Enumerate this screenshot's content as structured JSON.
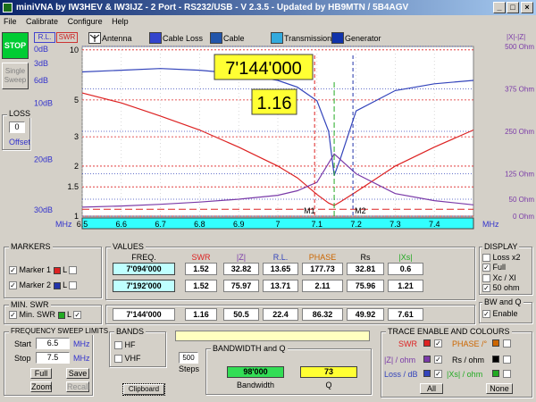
{
  "window": {
    "title": "miniVNA by IW3HEV & IW3IJZ - 2 Port - RS232/USB - V 2.3.5 - Updated by HB9MTN / 5B4AGV"
  },
  "menu": {
    "file": "File",
    "calibrate": "Calibrate",
    "configure": "Configure",
    "help": "Help"
  },
  "left": {
    "stop": "STOP",
    "single": "Single",
    "sweep": "Sweep",
    "loss_title": "LOSS",
    "loss_value": "0",
    "offset": "Offset"
  },
  "toolbar": {
    "rl": "R.L.",
    "swr": "SWR",
    "antenna": "Antenna",
    "cable_loss": "Cable Loss",
    "cable_length": "Cable Length",
    "transmission": "Transmission",
    "generator": "Generator",
    "xrz": "|X|-|Z|"
  },
  "chart": {
    "left_db_labels": [
      "0dB",
      "3dB",
      "6dB",
      "10dB",
      "20dB",
      "30dB"
    ],
    "swr_ticks": [
      "10",
      "5",
      "3",
      "2",
      "1.5",
      "1"
    ],
    "ohm_labels": [
      "500 Ohm",
      "375 Ohm",
      "250 Ohm",
      "125 Ohm",
      "50 Ohm",
      "0 Ohm"
    ],
    "freq_ticks": [
      "6.5",
      "6.6",
      "6.7",
      "6.8",
      "6.9",
      "7",
      "7.1",
      "7.2",
      "7.3",
      "7.4"
    ],
    "mhz_left": "MHz",
    "mhz_right": "MHz",
    "marker1": "M1",
    "marker2": "M2",
    "freq_callout": "7'144'000",
    "swr_callout": "1.16",
    "colors": {
      "swr": "#dd2222",
      "z": "#3344bb",
      "rl": "#7a3aa8",
      "bg": "#ffffff",
      "freqbar": "#33ffff"
    }
  },
  "chart_data": {
    "type": "line",
    "xlabel": "MHz",
    "xlim": [
      6.5,
      7.5
    ],
    "series": [
      {
        "name": "SWR",
        "x": [
          6.5,
          6.6,
          6.7,
          6.8,
          6.9,
          7.0,
          7.05,
          7.1,
          7.13,
          7.144,
          7.16,
          7.2,
          7.3,
          7.4,
          7.5
        ],
        "values": [
          5.5,
          4.8,
          4.0,
          3.3,
          2.6,
          2.0,
          1.7,
          1.35,
          1.2,
          1.16,
          1.22,
          1.4,
          2.0,
          2.6,
          3.3
        ]
      },
      {
        "name": "|Z| / ohm",
        "x": [
          6.5,
          6.6,
          6.7,
          6.8,
          6.9,
          7.0,
          7.05,
          7.1,
          7.13,
          7.144,
          7.16,
          7.2,
          7.3,
          7.4,
          7.5
        ],
        "values": [
          425,
          430,
          435,
          430,
          420,
          400,
          380,
          340,
          250,
          120,
          170,
          310,
          370,
          390,
          400
        ]
      },
      {
        "name": "Loss / dB",
        "x": [
          6.5,
          6.6,
          6.7,
          6.8,
          6.9,
          7.0,
          7.05,
          7.1,
          7.144,
          7.2,
          7.3,
          7.4,
          7.5
        ],
        "values": [
          3.2,
          3.6,
          4.2,
          5.0,
          6.0,
          7.4,
          9,
          12,
          22,
          15,
          8,
          5.5,
          4
        ]
      }
    ]
  },
  "markers": {
    "title": "MARKERS",
    "m1": "Marker 1",
    "m2": "Marker 2",
    "l": "L",
    "min_title": "MIN. SWR",
    "min": "Min. SWR"
  },
  "values": {
    "title": "VALUES",
    "headers": [
      "FREQ.",
      "SWR",
      "|Z|",
      "R.L.",
      "PHASE",
      "Rs",
      "|Xs|"
    ],
    "rows": [
      [
        "7'094'000",
        "1.52",
        "32.82",
        "13.65",
        "177.73",
        "32.81",
        "0.6"
      ],
      [
        "7'192'000",
        "1.52",
        "75.97",
        "13.71",
        "2.11",
        "75.96",
        "1.21"
      ],
      [
        "7'144'000",
        "1.16",
        "50.5",
        "22.4",
        "86.32",
        "49.92",
        "7.61"
      ]
    ]
  },
  "display": {
    "title": "DISPLAY",
    "loss": "Loss x2",
    "full": "Full",
    "xcxl": "Xc / Xl",
    "ohm50": "50 ohm"
  },
  "bwq": {
    "title": "BW and Q",
    "enable": "Enable"
  },
  "sweep": {
    "title": "FREQUENCY SWEEP LIMITS",
    "start": "Start",
    "start_val": "6.5",
    "stop": "Stop",
    "stop_val": "7.5",
    "mhz": "MHz",
    "full": "Full",
    "save": "Save",
    "zoom": "Zoom",
    "recall": "Recall"
  },
  "bands": {
    "title": "BANDS",
    "hf": "HF",
    "vhf": "VHF"
  },
  "steps": {
    "value": "500",
    "label": "Steps"
  },
  "clipboard": "Clipboard",
  "bandwidth": {
    "title": "BANDWIDTH and Q",
    "bw": "98'000",
    "bw_label": "Bandwidth",
    "q": "73",
    "q_label": "Q"
  },
  "trace": {
    "title": "TRACE ENABLE AND COLOURS",
    "swr": "SWR",
    "phase": "PHASE /°",
    "z": "|Z| / ohm",
    "rs": "Rs / ohm",
    "loss": "Loss / dB",
    "xs": "|Xs| / ohm",
    "all": "All",
    "none": "None"
  }
}
